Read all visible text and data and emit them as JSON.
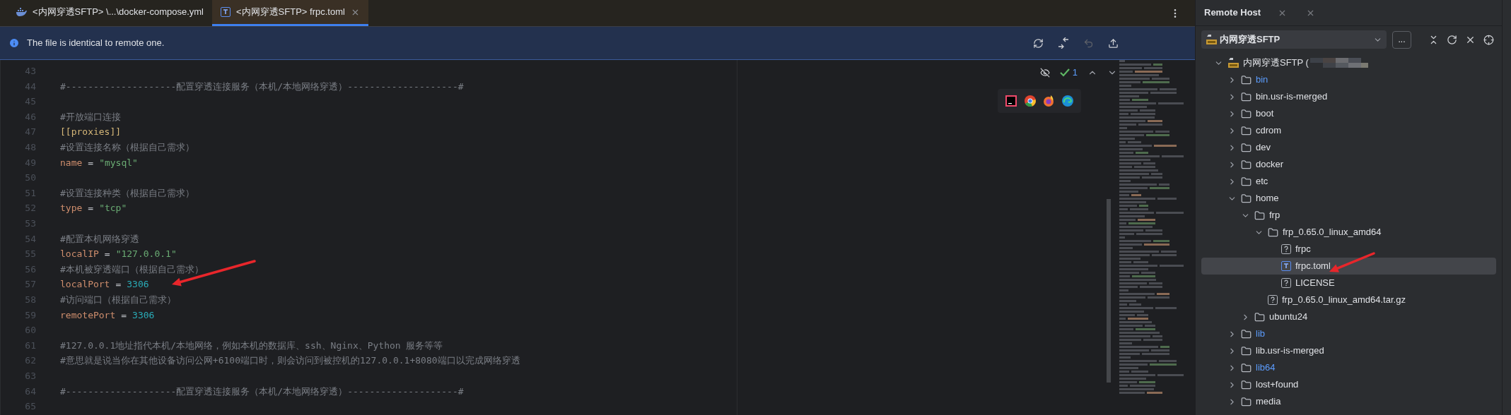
{
  "editor_tabs": [
    {
      "label": "<内网穿透SFTP> \\...\\docker-compose.yml",
      "kind": "docker",
      "selected": false
    },
    {
      "label": "<内网穿透SFTP> frpc.toml",
      "kind": "toml",
      "selected": true
    }
  ],
  "notification": {
    "text": "The file is identical to remote one."
  },
  "inspection": {
    "count": "1"
  },
  "code_lines": [
    {
      "number": "43",
      "kind": "blank"
    },
    {
      "number": "44",
      "kind": "comment",
      "text": "#--------------------配置穿透连接服务（本机/本地网络穿透）--------------------#"
    },
    {
      "number": "45",
      "kind": "blank"
    },
    {
      "number": "46",
      "kind": "comment",
      "text": "#开放端口连接"
    },
    {
      "number": "47",
      "kind": "section",
      "text": "[[proxies]]"
    },
    {
      "number": "48",
      "kind": "comment",
      "text": "#设置连接名称（根据自己需求）"
    },
    {
      "number": "49",
      "kind": "string_pair",
      "key": "name",
      "operator": "=",
      "value": "\"mysql\""
    },
    {
      "number": "50",
      "kind": "blank"
    },
    {
      "number": "51",
      "kind": "comment",
      "text": "#设置连接种类（根据自己需求）"
    },
    {
      "number": "52",
      "kind": "string_pair",
      "key": "type",
      "operator": "=",
      "value": "\"tcp\""
    },
    {
      "number": "53",
      "kind": "blank"
    },
    {
      "number": "54",
      "kind": "comment",
      "text": "#配置本机网络穿透"
    },
    {
      "number": "55",
      "kind": "string_pair",
      "key": "localIP",
      "operator": "=",
      "value": "\"127.0.0.1\""
    },
    {
      "number": "56",
      "kind": "comment",
      "text": "#本机被穿透端口（根据自己需求）"
    },
    {
      "number": "57",
      "kind": "number_pair",
      "key": "localPort",
      "operator": "=",
      "value": "3306"
    },
    {
      "number": "58",
      "kind": "comment",
      "text": "#访问端口（根据自己需求）"
    },
    {
      "number": "59",
      "kind": "number_pair",
      "key": "remotePort",
      "operator": "=",
      "value": "3306"
    },
    {
      "number": "60",
      "kind": "blank"
    },
    {
      "number": "61",
      "kind": "comment",
      "text": "#127.0.0.1地址指代本机/本地网络，例如本机的数据库、ssh、Nginx、Python 服务等等"
    },
    {
      "number": "62",
      "kind": "comment",
      "text": "#意思就是说当你在其他设备访问公网+6100端口时，则会访问到被控机的127.0.0.1+8080端口以完成网络穿透"
    },
    {
      "number": "63",
      "kind": "blank"
    },
    {
      "number": "64",
      "kind": "comment",
      "text": "#--------------------配置穿透连接服务（本机/本地网络穿透）--------------------#"
    },
    {
      "number": "65",
      "kind": "blank"
    }
  ],
  "remote_host": {
    "title": "Remote Host",
    "server": "内网穿透SFTP",
    "more_button": "...",
    "tree": [
      {
        "label": "内网穿透SFTP (",
        "kind": "server",
        "expanded": true,
        "link": false,
        "selected": false,
        "children": [
          {
            "label": "bin",
            "kind": "folder",
            "expanded": false,
            "link": true,
            "selected": false
          },
          {
            "label": "bin.usr-is-merged",
            "kind": "folder",
            "expanded": false,
            "link": false,
            "selected": false
          },
          {
            "label": "boot",
            "kind": "folder",
            "expanded": false,
            "link": false,
            "selected": false
          },
          {
            "label": "cdrom",
            "kind": "folder",
            "expanded": false,
            "link": false,
            "selected": false
          },
          {
            "label": "dev",
            "kind": "folder",
            "expanded": false,
            "link": false,
            "selected": false
          },
          {
            "label": "docker",
            "kind": "folder",
            "expanded": false,
            "link": false,
            "selected": false
          },
          {
            "label": "etc",
            "kind": "folder",
            "expanded": false,
            "link": false,
            "selected": false
          },
          {
            "label": "home",
            "kind": "folder",
            "expanded": true,
            "link": false,
            "selected": false,
            "children": [
              {
                "label": "frp",
                "kind": "folder",
                "expanded": true,
                "link": false,
                "selected": false,
                "children": [
                  {
                    "label": "frp_0.65.0_linux_amd64",
                    "kind": "folder",
                    "expanded": true,
                    "link": false,
                    "selected": false,
                    "children": [
                      {
                        "label": "frpc",
                        "kind": "unknown",
                        "link": false,
                        "selected": false
                      },
                      {
                        "label": "frpc.toml",
                        "kind": "toml",
                        "link": false,
                        "selected": true
                      },
                      {
                        "label": "LICENSE",
                        "kind": "unknown",
                        "link": false,
                        "selected": false
                      }
                    ]
                  },
                  {
                    "label": "frp_0.65.0_linux_amd64.tar.gz",
                    "kind": "unknown",
                    "link": false,
                    "selected": false
                  }
                ]
              },
              {
                "label": "ubuntu24",
                "kind": "folder",
                "expanded": false,
                "link": false,
                "selected": false
              }
            ]
          },
          {
            "label": "lib",
            "kind": "folder",
            "expanded": false,
            "link": true,
            "selected": false
          },
          {
            "label": "lib.usr-is-merged",
            "kind": "folder",
            "expanded": false,
            "link": false,
            "selected": false
          },
          {
            "label": "lib64",
            "kind": "folder",
            "expanded": false,
            "link": true,
            "selected": false
          },
          {
            "label": "lost+found",
            "kind": "folder",
            "expanded": false,
            "link": false,
            "selected": false
          },
          {
            "label": "media",
            "kind": "folder",
            "expanded": false,
            "link": false,
            "selected": false
          }
        ]
      }
    ]
  }
}
